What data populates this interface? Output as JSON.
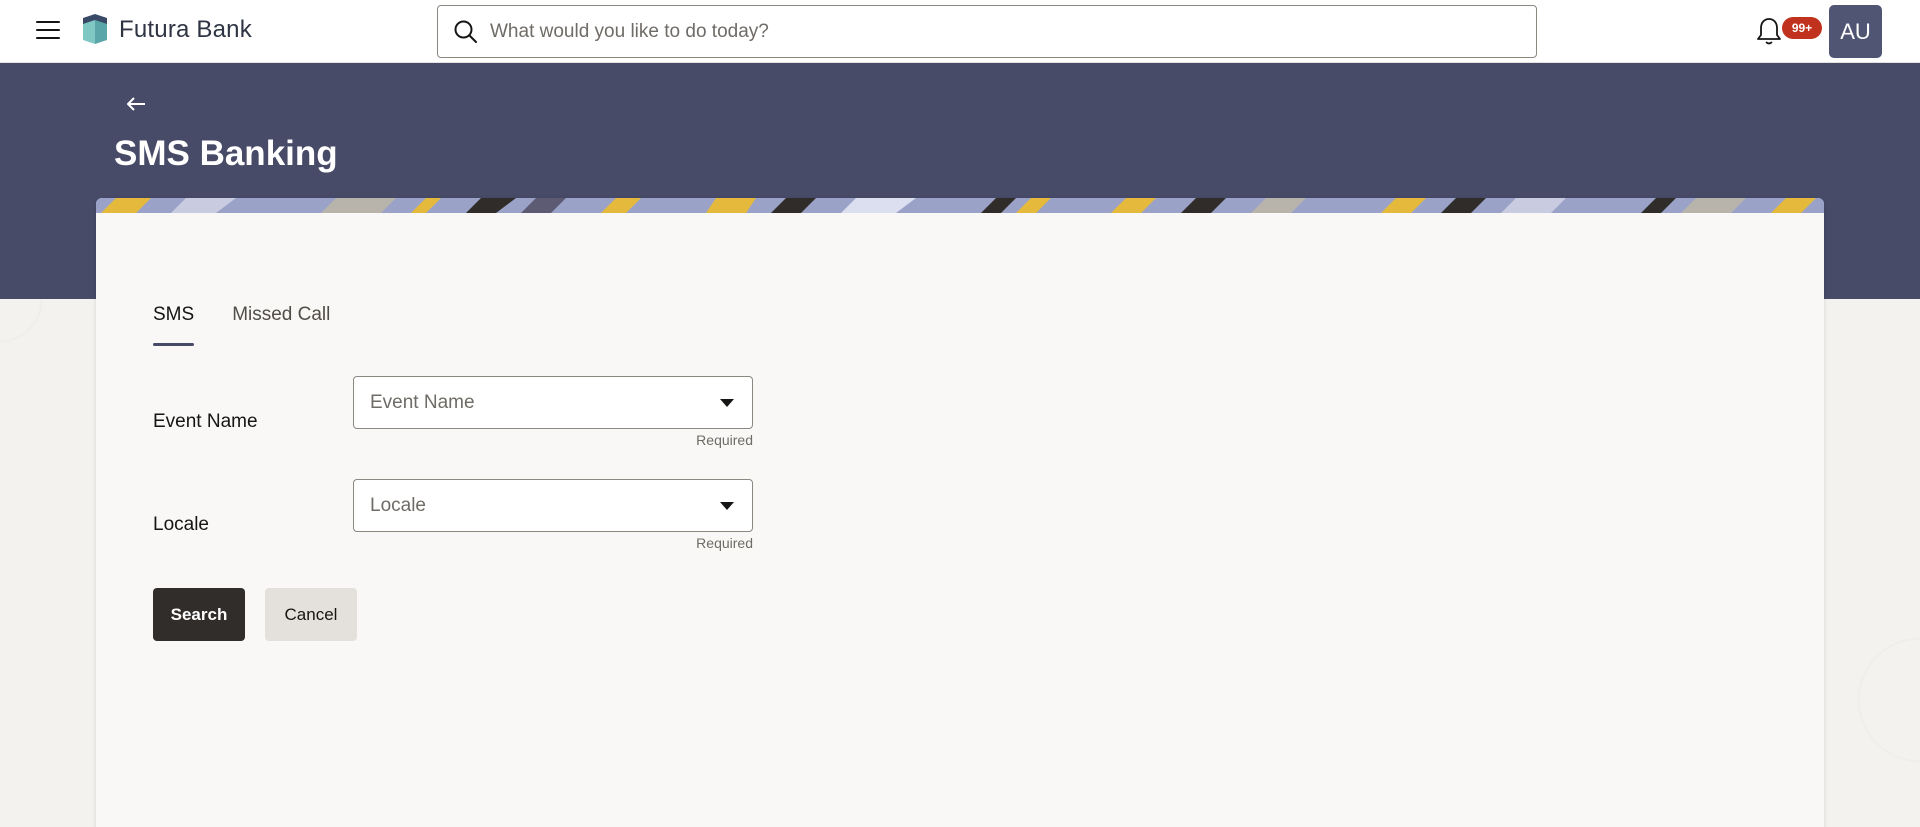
{
  "header": {
    "brand": "Futura Bank",
    "search_placeholder": "What would you like to do today?",
    "notifications_badge": "99+",
    "avatar_initials": "AU",
    "icons": [
      "menu-icon",
      "bank-logo",
      "search-icon",
      "bell-icon"
    ]
  },
  "page": {
    "title": "SMS Banking",
    "back_icon": "arrow-left-icon"
  },
  "tabs": [
    {
      "label": "SMS",
      "active": true
    },
    {
      "label": "Missed Call",
      "active": false
    }
  ],
  "form": {
    "event_name": {
      "label": "Event Name",
      "placeholder": "Event Name",
      "hint": "Required"
    },
    "locale": {
      "label": "Locale",
      "placeholder": "Locale",
      "hint": "Required"
    }
  },
  "actions": {
    "search_label": "Search",
    "cancel_label": "Cancel"
  },
  "colors": {
    "hero": "#474b68",
    "primary_button": "#312d2a",
    "badge": "#c0321e",
    "avatar": "#4f5573"
  }
}
